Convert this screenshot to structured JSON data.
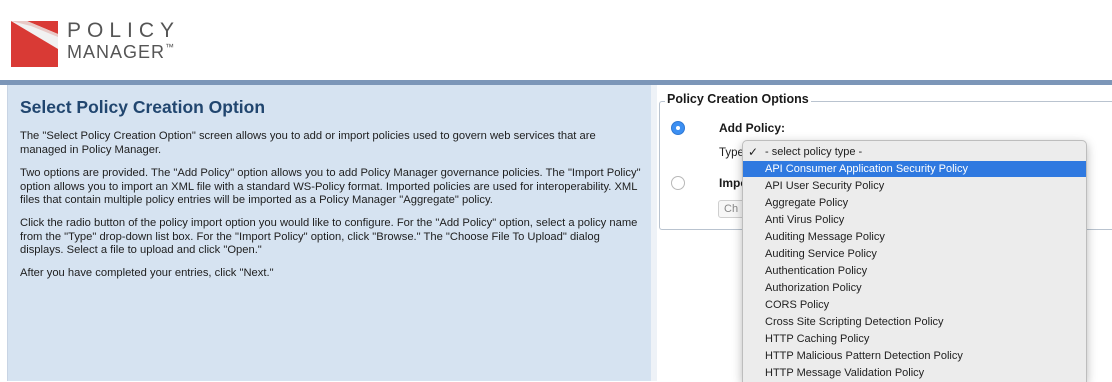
{
  "header": {
    "logo_line1": "POLICY",
    "logo_line2": "MANAGER",
    "logo_tm": "™"
  },
  "info": {
    "title": "Select Policy Creation Option",
    "paragraphs": [
      "The \"Select Policy Creation Option\" screen allows you to add or import policies used to govern web services that are managed in Policy Manager.",
      "Two options are provided. The \"Add Policy\" option allows you to add Policy Manager governance policies. The \"Import Policy\" option allows you to import an XML file with a standard WS-Policy format. Imported policies are used for interoperability. XML files that contain multiple policy entries will be imported as a Policy Manager \"Aggregate\" policy.",
      "Click the radio button of the policy import option you would like to configure. For the \"Add Policy\" option, select a policy name from the \"Type\" drop-down list box. For the \"Import Policy\" option, click \"Browse.\" The \"Choose File To Upload\" dialog displays. Select a file to upload and click \"Open.\"",
      "After you have completed your entries, click \"Next.\""
    ]
  },
  "options": {
    "legend": "Policy Creation Options",
    "add_policy_label": "Add Policy:",
    "type_label": "Type",
    "import_label": "Impo",
    "choose_file_label": "Ch"
  },
  "dropdown": {
    "selected_index": 0,
    "highlighted_index": 1,
    "items": [
      "- select policy type -",
      "API Consumer Application Security Policy",
      "API User Security Policy",
      "Aggregate Policy",
      "Anti Virus Policy",
      "Auditing Message Policy",
      "Auditing Service Policy",
      "Authentication Policy",
      "Authorization Policy",
      "CORS Policy",
      "Cross Site Scripting Detection Policy",
      "HTTP Caching Policy",
      "HTTP Malicious Pattern Detection Policy",
      "HTTP Message Validation Policy"
    ]
  },
  "colors": {
    "brand_red": "#d93a35",
    "header_rule": "#7c96b8",
    "panel_bg": "#d6e3f1",
    "title_blue": "#21466f",
    "highlight": "#2f79e0"
  }
}
